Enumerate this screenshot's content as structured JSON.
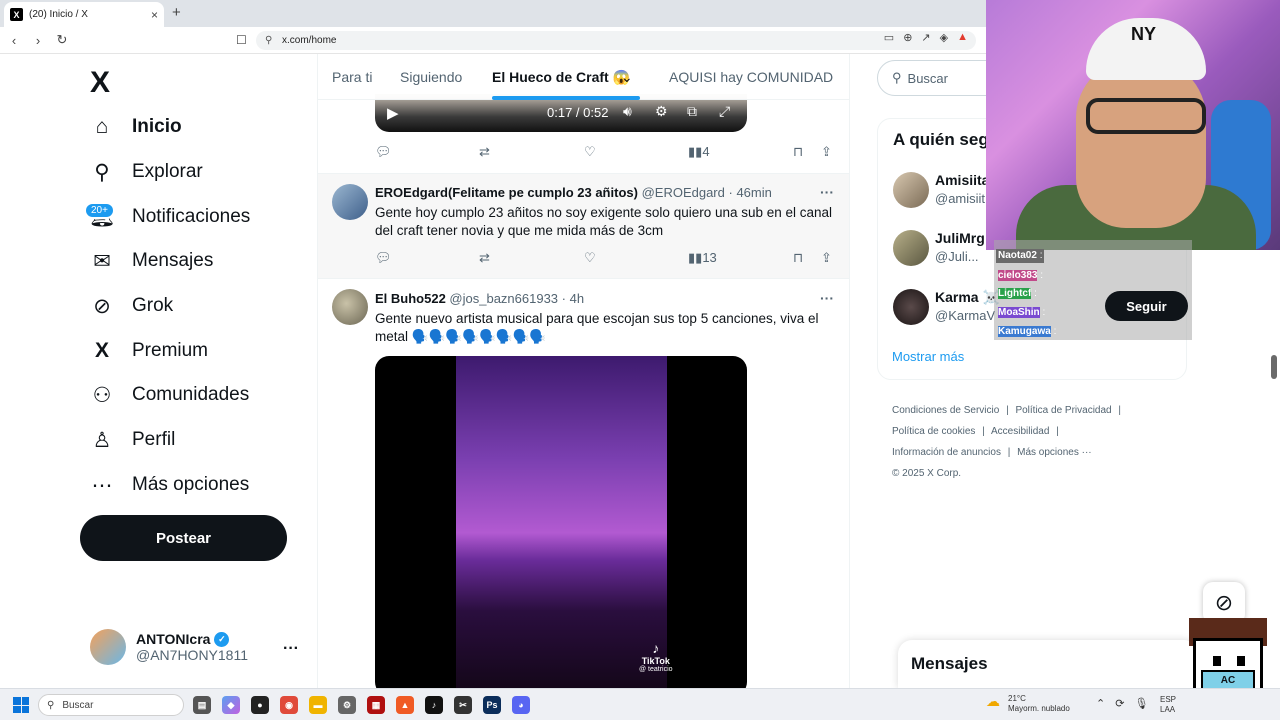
{
  "browser": {
    "tab_title": "(20) Inicio / X",
    "tab_close": "×",
    "new_tab": "+",
    "url": "x.com/home"
  },
  "sidebar": {
    "logo": "X",
    "notif_badge": "20+",
    "items": [
      {
        "label": "Inicio",
        "icon": "home-icon"
      },
      {
        "label": "Explorar",
        "icon": "search-icon"
      },
      {
        "label": "Notificaciones",
        "icon": "bell-icon"
      },
      {
        "label": "Mensajes",
        "icon": "mail-icon"
      },
      {
        "label": "Grok",
        "icon": "grok-icon"
      },
      {
        "label": "Premium",
        "icon": "x-icon"
      },
      {
        "label": "Comunidades",
        "icon": "people-icon"
      },
      {
        "label": "Perfil",
        "icon": "person-icon"
      },
      {
        "label": "Más opciones",
        "icon": "more-circle-icon"
      }
    ],
    "post_button": "Postear",
    "profile": {
      "name": "ANTONIcra",
      "handle": "@AN7HONY1811",
      "more": "···"
    }
  },
  "feed": {
    "tabs": [
      "Para ti",
      "Siguiendo",
      "El Hueco de Craft 😱",
      "AQUISI hay COMUNIDAD"
    ],
    "active_tab": 2,
    "video1": {
      "time": "0:17 / 0:52"
    },
    "tweet1_actions": {
      "views": "4"
    },
    "tweets": [
      {
        "name": "EROEdgard(Felitame pe cumplo 23 añitos)",
        "handle": "@EROEdgard",
        "time": "· 46min",
        "text": "Gente hoy cumplo 23 añitos no soy exigente solo quiero una sub en el canal del craft tener novia y que me mida más de 3cm",
        "views": "13"
      },
      {
        "name": "El Buho522",
        "handle": "@jos_bazn661933",
        "time": "· 4h",
        "text": "Gente nuevo artista musical para que escojan sus top 5 canciones, viva el metal 🗣️🗣️🗣️🗣️🗣️🗣️🗣️🗣️",
        "video_brand": "TikTok",
        "video_user": "@ teatricio"
      }
    ]
  },
  "right": {
    "search_placeholder": "Buscar",
    "who_title": "A quién seg",
    "suggestions": [
      {
        "name": "Amisiita",
        "handle": "@amisiit"
      },
      {
        "name": "JuliMrg",
        "handle": "@Juli..."
      },
      {
        "name": "Karma ☠️",
        "handle": "@KarmaV"
      }
    ],
    "follow_button": "Seguir",
    "show_more": "Mostrar más",
    "footer": [
      [
        "Condiciones de Servicio",
        "|",
        "Política de Privacidad",
        "|"
      ],
      [
        "Política de cookies",
        "|",
        "Accesibilidad",
        "|"
      ],
      [
        "Información de anuncios",
        "|",
        "Más opciones ···"
      ],
      [
        "© 2025 X Corp."
      ]
    ],
    "messages": "Mensajes"
  },
  "stream_chat": [
    {
      "user": "Naota02",
      "sep": ":"
    },
    {
      "user": "cielo383",
      "sep": ":"
    },
    {
      "user": "Lightcf",
      "sep": ":"
    },
    {
      "user": "MoaShin",
      "sep": ":"
    },
    {
      "user": "Kamugawa",
      "sep": ":"
    }
  ],
  "mascot_text": "AC",
  "taskbar": {
    "search": "Buscar",
    "weather_temp": "21°C",
    "weather_desc": "Mayorm. nublado",
    "lang1": "ESP",
    "lang2": "LAA"
  },
  "colors": {
    "accent": "#1d9bf0",
    "text": "#0f1419",
    "muted": "#536471"
  }
}
